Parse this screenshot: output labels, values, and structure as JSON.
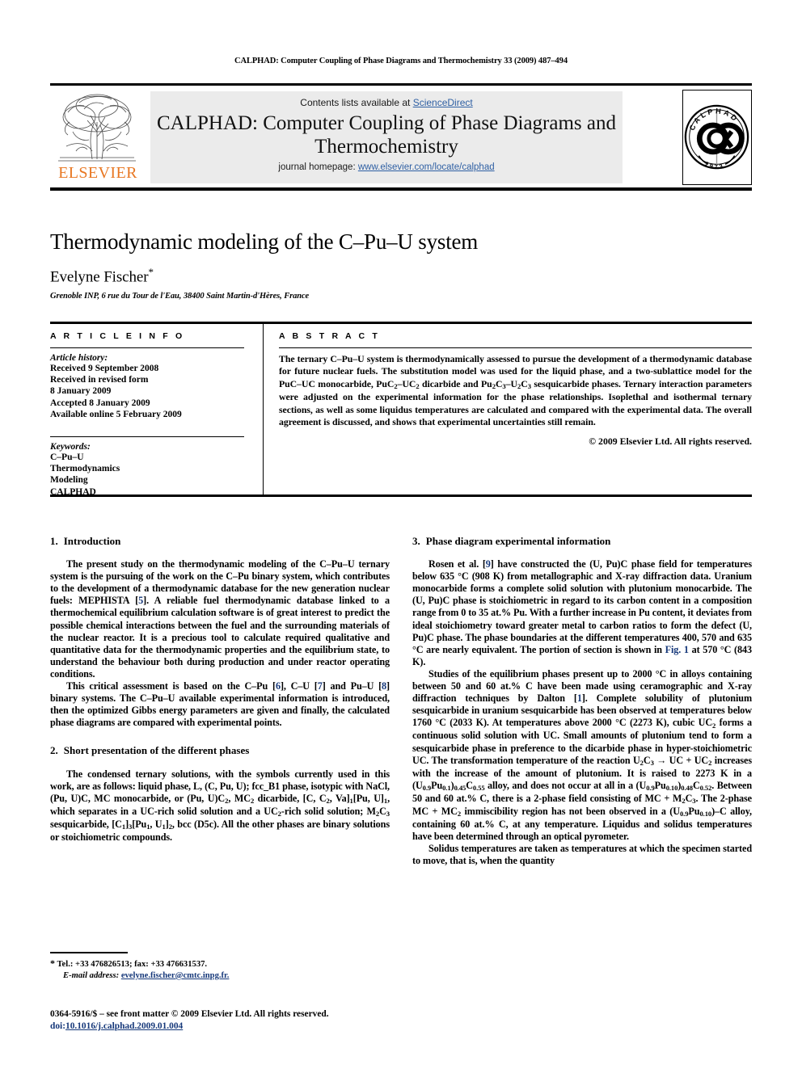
{
  "running_head": "CALPHAD: Computer Coupling of Phase Diagrams and Thermochemistry 33 (2009) 487–494",
  "masthead": {
    "contents_prefix": "Contents lists available at ",
    "sciencedirect": "ScienceDirect",
    "journal_title": "CALPHAD: Computer Coupling of Phase Diagrams and Thermochemistry",
    "homepage_prefix": "journal homepage: ",
    "homepage_url": "www.elsevier.com/locate/calphad",
    "publisher_logo_word": "ELSEVIER",
    "stamp_text": "CALPHAD",
    "stamp_year": "1973",
    "band_color": "#ebebeb",
    "link_color": "#2e5fa3",
    "elsevier_orange": "#E87722"
  },
  "title_block": {
    "title": "Thermodynamic modeling of the C–Pu–U system",
    "author": "Evelyne Fischer",
    "author_marker": "*",
    "affiliation": "Grenoble INP, 6 rue du Tour de l'Eau, 38400 Saint Martin-d'Hères, France"
  },
  "article_info": {
    "heading": "A R T I C L E    I N F O",
    "history_label": "Article history:",
    "history_lines": [
      "Received 9 September 2008",
      "Received in revised form",
      "8 January 2009",
      "Accepted 8 January 2009",
      "Available online 5 February 2009"
    ],
    "keywords_label": "Keywords:",
    "keywords": [
      "C–Pu–U",
      "Thermodynamics",
      "Modeling",
      "CALPHAD"
    ]
  },
  "abstract": {
    "heading": "A B S T R A C T",
    "paragraph_1": "The ternary C–Pu–U system is thermodynamically assessed to pursue the development of a thermodynamic database for future nuclear fuels. The substitution model was used for the liquid phase, and a two-sublattice model for the PuC–UC monocarbide, PuC",
    "paragraph_1b": "–UC",
    "paragraph_1c": " dicarbide and Pu",
    "paragraph_1d": "C",
    "paragraph_1e": "–U",
    "paragraph_1f": "C",
    "paragraph_1g": " sesquicarbide phases. Ternary interaction parameters were adjusted on the experimental information for the phase relationships. Isoplethal and isothermal ternary sections, as well as some liquidus temperatures are calculated and compared with the experimental data. The overall agreement is discussed, and shows that experimental uncertainties still remain.",
    "copyright": "© 2009 Elsevier Ltd. All rights reserved."
  },
  "sections": {
    "s1": {
      "num": "1.",
      "title": "Introduction",
      "p1a": "The present study on the thermodynamic modeling of the C–Pu–U ternary system is the pursuing of the work on the C–Pu binary system, which contributes to the development of a thermodynamic database for the new generation nuclear fuels: MEPHISTA [",
      "p1_ref": "5",
      "p1b": "]. A reliable fuel thermodynamic database linked to a thermochemical equilibrium calculation software is of great interest to predict the possible chemical interactions between the fuel and the surrounding materials of the nuclear reactor. It is a precious tool to calculate required qualitative and quantitative data for the thermodynamic properties and the equilibrium state, to understand the behaviour both during production and under reactor operating conditions.",
      "p2a": "This critical assessment is based on the C–Pu [",
      "p2_ref1": "6",
      "p2b": "], C–U [",
      "p2_ref2": "7",
      "p2c": "] and Pu–U [",
      "p2_ref3": "8",
      "p2d": "] binary systems. The C–Pu–U available experimental information is introduced, then the optimized Gibbs energy parameters are given and finally, the calculated phase diagrams are compared with experimental points."
    },
    "s2": {
      "num": "2.",
      "title": "Short presentation of the different phases",
      "p1a": "The condensed ternary solutions, with the symbols currently used in this work, are as follows: liquid phase, L, (C, Pu, U); fcc_B1 phase, isotypic with NaCl, (Pu, U)C, MC monocarbide, or (Pu, U)C",
      "p1b": ", MC",
      "p1c": " dicarbide, [C, C",
      "p1d": ", Va]",
      "p1e": "[Pu, U]",
      "p1f": ", which separates in a UC-rich solid solution and a UC",
      "p1g": "-rich solid solution; M",
      "p1h": "C",
      "p1i": " sesquicarbide, [C",
      "p1j": "]",
      "p1k": "[Pu",
      "p1l": ", U",
      "p1m": "]",
      "p1n": ", bcc (D5c). All the other phases are binary solutions or stoichiometric compounds."
    },
    "s3": {
      "num": "3.",
      "title": "Phase diagram experimental information",
      "p1a": "Rosen et al. [",
      "p1_ref": "9",
      "p1b": "] have constructed the (U, Pu)C phase field for temperatures below 635 °C (908 K) from metallographic and X-ray diffraction data.  Uranium monocarbide forms a complete solid solution with plutonium monocarbide. The (U, Pu)C phase is stoichiometric in regard to its carbon content in a composition range from 0 to 35 at.% Pu. With a further increase in Pu content, it deviates from ideal stoichiometry toward greater metal to carbon ratios to form the defect (U, Pu)C phase. The phase boundaries at the different temperatures 400, 570 and 635 °C are nearly equivalent. The portion of section is shown in ",
      "p1_fig": "Fig. 1",
      "p1c": " at 570 °C (843 K).",
      "p2a": "Studies of the equilibrium phases present up to 2000 °C in alloys containing between 50 and 60 at.% C have been made using ceramographic and X-ray diffraction techniques by Dalton [",
      "p2_ref": "1",
      "p2b": "]. Complete solubility of plutonium sesquicarbide in uranium sesquicarbide has been observed at temperatures below 1760 °C (2033 K). At temperatures above 2000 °C (2273 K), cubic UC",
      "p2c": " forms a continuous solid solution with UC. Small amounts of plutonium tend to form a sesquicarbide phase in preference to the dicarbide phase in hyper-stoichiometric UC. The transformation temperature of the reaction U",
      "p2d": "C",
      "p2e": "  →  UC + UC",
      "p2f": " increases with the increase of the amount of plutonium. It is raised to 2273 K in a (U",
      "p2g": "Pu",
      "p2h": ")",
      "p2i": "C",
      "p2j": " alloy, and does not occur at all in a (U",
      "p2k": "Pu",
      "p2l": ")",
      "p2m": "C",
      "p2n": ". Between 50 and 60 at.% C, there is a 2-phase field consisting of MC + M",
      "p2o": "C",
      "p2p": ". The 2-phase MC + MC",
      "p2q": " immiscibility region has not been observed in a (U",
      "p2r": "Pu",
      "p2s": ")–C alloy, containing 60 at.% C, at any temperature. Liquidus and solidus temperatures have been determined through an optical pyrometer.",
      "p3": "Solidus temperatures are taken as temperatures at which the specimen started to move, that is, when the quantity"
    }
  },
  "footnote": {
    "star": "*",
    "tel_line": "Tel.: +33 476826513; fax: +33 476631537.",
    "email_label": "E-mail address:",
    "email": "evelyne.fischer@cmtc.inpg.fr."
  },
  "footer": {
    "line1": "0364-5916/$ – see front matter © 2009 Elsevier Ltd. All rights reserved.",
    "doi_label": "doi:",
    "doi": "10.1016/j.calphad.2009.01.004"
  }
}
